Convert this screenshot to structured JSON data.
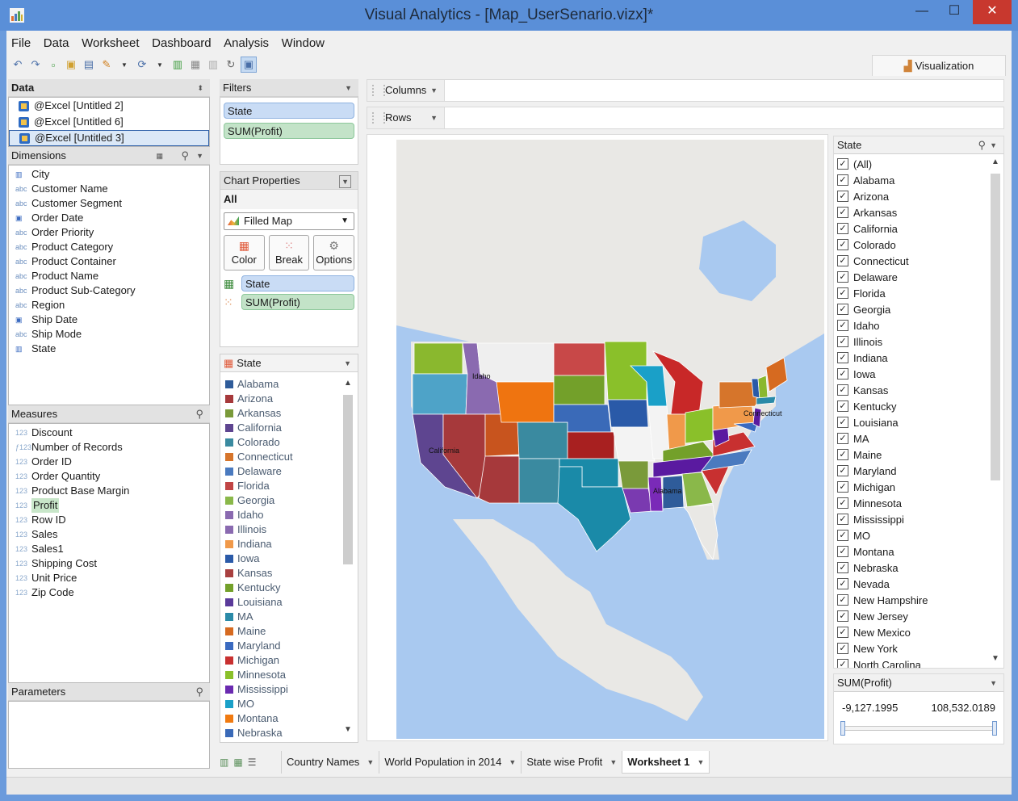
{
  "window": {
    "title": "Visual Analytics - [Map_UserSenario.vizx]*",
    "minimize": "—",
    "maximize": "☐",
    "close": "✕"
  },
  "menu": [
    "File",
    "Data",
    "Worksheet",
    "Dashboard",
    "Analysis",
    "Window"
  ],
  "visualization_tab": "Visualization",
  "data_panel": {
    "title": "Data",
    "sources": [
      "@Excel [Untitled 2]",
      "@Excel [Untitled 6]",
      "@Excel [Untitled 3]"
    ],
    "selected_source_index": 2
  },
  "dimensions": {
    "title": "Dimensions",
    "items": [
      {
        "icon": "geo",
        "label": "City"
      },
      {
        "icon": "abc",
        "label": "Customer Name"
      },
      {
        "icon": "abc",
        "label": "Customer Segment"
      },
      {
        "icon": "date",
        "label": "Order Date"
      },
      {
        "icon": "abc",
        "label": "Order Priority"
      },
      {
        "icon": "abc",
        "label": "Product Category"
      },
      {
        "icon": "abc",
        "label": "Product Container"
      },
      {
        "icon": "abc",
        "label": "Product Name"
      },
      {
        "icon": "abc",
        "label": "Product Sub-Category"
      },
      {
        "icon": "abc",
        "label": "Region"
      },
      {
        "icon": "date",
        "label": "Ship Date"
      },
      {
        "icon": "abc",
        "label": "Ship Mode"
      },
      {
        "icon": "geo",
        "label": "State"
      }
    ]
  },
  "measures": {
    "title": "Measures",
    "items": [
      {
        "icon": "123",
        "label": "Discount"
      },
      {
        "icon": "fx123",
        "label": "Number of Records"
      },
      {
        "icon": "123",
        "label": "Order ID"
      },
      {
        "icon": "123",
        "label": "Order Quantity"
      },
      {
        "icon": "123",
        "label": "Product Base Margin"
      },
      {
        "icon": "123",
        "label": "Profit",
        "highlighted": true
      },
      {
        "icon": "123",
        "label": "Row ID"
      },
      {
        "icon": "123",
        "label": "Sales"
      },
      {
        "icon": "123",
        "label": "Sales1"
      },
      {
        "icon": "123",
        "label": "Shipping Cost"
      },
      {
        "icon": "123",
        "label": "Unit Price"
      },
      {
        "icon": "123",
        "label": "Zip Code"
      }
    ]
  },
  "parameters": {
    "title": "Parameters"
  },
  "filters": {
    "title": "Filters",
    "items": [
      {
        "label": "State",
        "kind": "dimension"
      },
      {
        "label": "SUM(Profit)",
        "kind": "measure"
      }
    ]
  },
  "chart_properties": {
    "title": "Chart Properties",
    "scope": "All",
    "chart_type": "Filled Map",
    "buttons": [
      "Color",
      "Break",
      "Options"
    ],
    "color_pill": "State",
    "size_pill": "SUM(Profit)"
  },
  "legend": {
    "title": "State",
    "items": [
      {
        "label": "Alabama",
        "color": "#2f5c9a"
      },
      {
        "label": "Arizona",
        "color": "#a6393b"
      },
      {
        "label": "Arkansas",
        "color": "#7a9a3a"
      },
      {
        "label": "California",
        "color": "#5e4590"
      },
      {
        "label": "Colorado",
        "color": "#3a8aa0"
      },
      {
        "label": "Connecticut",
        "color": "#d6752b"
      },
      {
        "label": "Delaware",
        "color": "#4a7abf"
      },
      {
        "label": "Florida",
        "color": "#c04545"
      },
      {
        "label": "Georgia",
        "color": "#8ab84a"
      },
      {
        "label": "Idaho",
        "color": "#8a6ab0"
      },
      {
        "label": "Illinois",
        "color": "#8a6ab0"
      },
      {
        "label": "Indiana",
        "color": "#f0994a"
      },
      {
        "label": "Iowa",
        "color": "#2a5aa8"
      },
      {
        "label": "Kansas",
        "color": "#a84040"
      },
      {
        "label": "Kentucky",
        "color": "#73a02a"
      },
      {
        "label": "Louisiana",
        "color": "#5a3a9a"
      },
      {
        "label": "MA",
        "color": "#2a8aa8"
      },
      {
        "label": "Maine",
        "color": "#d66a20"
      },
      {
        "label": "Maryland",
        "color": "#3a6ac0"
      },
      {
        "label": "Michigan",
        "color": "#c83030"
      },
      {
        "label": "Minnesota",
        "color": "#8ac02a"
      },
      {
        "label": "Mississippi",
        "color": "#6a2ab0"
      },
      {
        "label": "MO",
        "color": "#1aa0c8"
      },
      {
        "label": "Montana",
        "color": "#f07a10"
      },
      {
        "label": "Nebraska",
        "color": "#3a6ab8"
      }
    ]
  },
  "shelves": {
    "columns": "Columns",
    "rows": "Rows"
  },
  "state_filter": {
    "title": "State",
    "items": [
      "(All)",
      "Alabama",
      "Arizona",
      "Arkansas",
      "California",
      "Colorado",
      "Connecticut",
      "Delaware",
      "Florida",
      "Georgia",
      "Idaho",
      "Illinois",
      "Indiana",
      "Iowa",
      "Kansas",
      "Kentucky",
      "Louisiana",
      "MA",
      "Maine",
      "Maryland",
      "Michigan",
      "Minnesota",
      "Mississippi",
      "MO",
      "Montana",
      "Nebraska",
      "Nevada",
      "New Hampshire",
      "New Jersey",
      "New Mexico",
      "New York",
      "North Carolina"
    ]
  },
  "profit_filter": {
    "title": "SUM(Profit)",
    "min": "-9,127.1995",
    "max": "108,532.0189"
  },
  "map": {
    "labels": [
      "Idaho",
      "California",
      "Alabama",
      "Connecticut"
    ],
    "ocean": "#a9c9f0",
    "land": "#e9e8e5"
  },
  "sheet_tabs": [
    "Country Names",
    "World Population in 2014",
    "State wise Profit",
    "Worksheet 1"
  ],
  "active_sheet": "Worksheet 1"
}
